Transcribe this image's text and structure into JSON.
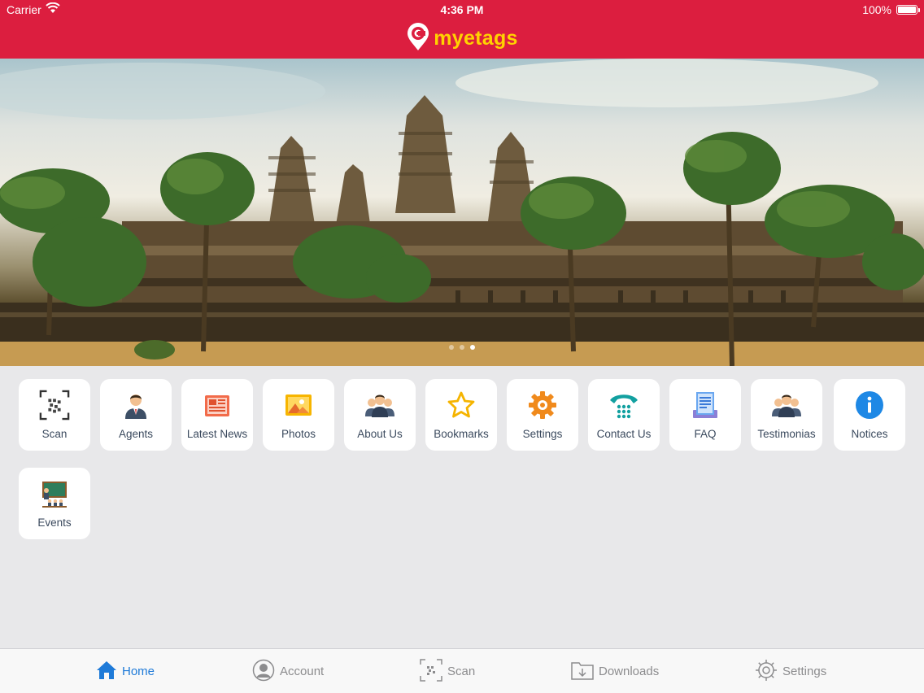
{
  "status_bar": {
    "carrier": "Carrier",
    "time": "4:36 PM",
    "battery": "100%"
  },
  "header": {
    "brand": "myetags",
    "brand_color": "#ffd200",
    "bar_color": "#dc1e3f"
  },
  "carousel": {
    "slide_count": 3,
    "active_index": 2
  },
  "menu": [
    {
      "label": "Scan",
      "icon": "qr-scan-icon"
    },
    {
      "label": "Agents",
      "icon": "agent-person-icon"
    },
    {
      "label": "Latest News",
      "icon": "newspaper-icon"
    },
    {
      "label": "Photos",
      "icon": "photo-icon"
    },
    {
      "label": "About Us",
      "icon": "group-icon"
    },
    {
      "label": "Bookmarks",
      "icon": "star-icon"
    },
    {
      "label": "Settings",
      "icon": "gear-icon"
    },
    {
      "label": "Contact Us",
      "icon": "telephone-icon"
    },
    {
      "label": "FAQ",
      "icon": "document-icon"
    },
    {
      "label": "Testimonias",
      "icon": "group-icon"
    },
    {
      "label": "Notices",
      "icon": "info-icon"
    },
    {
      "label": "Events",
      "icon": "classroom-icon"
    }
  ],
  "tabbar": [
    {
      "label": "Home",
      "icon": "home-icon",
      "active": true
    },
    {
      "label": "Account",
      "icon": "account-icon",
      "active": false
    },
    {
      "label": "Scan",
      "icon": "scan-icon",
      "active": false
    },
    {
      "label": "Downloads",
      "icon": "downloads-icon",
      "active": false
    },
    {
      "label": "Settings",
      "icon": "settings-icon",
      "active": false
    }
  ],
  "colors": {
    "active_tab": "#1e7ad8",
    "inactive_tab": "#8c8c8e",
    "tile_text": "#3b4a5e"
  }
}
